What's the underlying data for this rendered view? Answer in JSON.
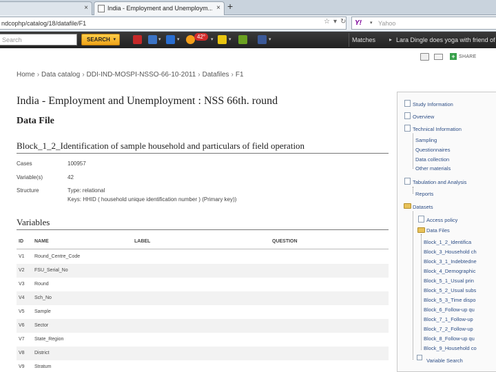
{
  "browser": {
    "tabs": [
      {
        "title": "",
        "close": "×"
      },
      {
        "title": "India - Employment and Unemploym...",
        "close": "×"
      }
    ],
    "new_tab": "+",
    "url": "ndcophp/catalog/18/datafile/F1",
    "search_engine": "Yahoo",
    "search_placeholder": "Yahoo"
  },
  "toolbar": {
    "search_placeholder": "Search",
    "search_button": "SEARCH",
    "weather": "42°",
    "links": [
      "Matches",
      "Lara Dingle does yoga with friend of"
    ]
  },
  "page_tools": {
    "share_label": "SHARE"
  },
  "breadcrumb": [
    "Home",
    "Data catalog",
    "DDI-IND-MOSPI-NSSO-66-10-2011",
    "Datafiles",
    "F1"
  ],
  "page_title": "India - Employment and Unemployment : NSS 66th. round",
  "section_title": "Data File",
  "file_title": "Block_1_2_Identification of sample household and particulars of field operation",
  "metadata": [
    {
      "key": "Cases",
      "value": "100957"
    },
    {
      "key": "Variable(s)",
      "value": "42"
    },
    {
      "key": "Structure",
      "value": "Type: relational"
    },
    {
      "key": "",
      "value": "Keys: HHID ( household unique identification number ) (Primary key))"
    }
  ],
  "variables_title": "Variables",
  "variables_table": {
    "headers": [
      "ID",
      "NAME",
      "LABEL",
      "QUESTION"
    ],
    "rows": [
      {
        "id": "V1",
        "name": "Round_Centre_Code",
        "label": "",
        "question": ""
      },
      {
        "id": "V2",
        "name": "FSU_Serial_No",
        "label": "",
        "question": ""
      },
      {
        "id": "V3",
        "name": "Round",
        "label": "",
        "question": ""
      },
      {
        "id": "V4",
        "name": "Sch_No",
        "label": "",
        "question": ""
      },
      {
        "id": "V5",
        "name": "Sample",
        "label": "",
        "question": ""
      },
      {
        "id": "V6",
        "name": "Sector",
        "label": "",
        "question": ""
      },
      {
        "id": "V7",
        "name": "State_Region",
        "label": "",
        "question": ""
      },
      {
        "id": "V8",
        "name": "District",
        "label": "",
        "question": ""
      },
      {
        "id": "V9",
        "name": "Stratum",
        "label": "",
        "question": ""
      }
    ]
  },
  "sidebar": {
    "study_information": "Study Information",
    "overview": "Overview",
    "technical_information": "Technical Information",
    "technical_items": [
      "Sampling",
      "Questionnaires",
      "Data collection",
      "Other materials"
    ],
    "tabulation": "Tabulation and Analysis",
    "reports": "Reports",
    "datasets": "Datasets",
    "access_policy": "Access policy",
    "data_files": "Data Files",
    "files": [
      "Block_1_2_Identifica",
      "Block_3_Household ch",
      "Block_3_1_Indebtedne",
      "Block_4_Demographic",
      "Block_5_1_Usual prin",
      "Block_5_2_Usual subs",
      "Block_5_3_Time dispo",
      "Block_6_Follow-up qu",
      "Block_7_1_Follow-up",
      "Block_7_2_Follow-up",
      "Block_8_Follow-up qu",
      "Block_9_Household co"
    ],
    "variable_search": "Variable Search"
  }
}
